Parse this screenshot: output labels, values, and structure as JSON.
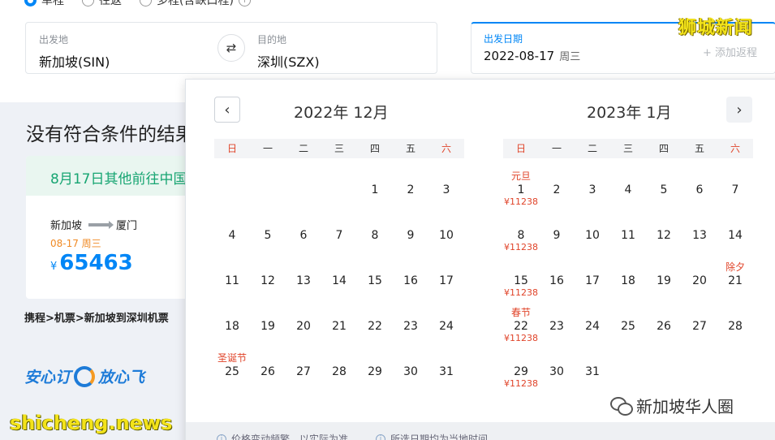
{
  "trip_types": [
    {
      "label": "单程",
      "selected": true
    },
    {
      "label": "往返",
      "selected": false
    },
    {
      "label": "多程(含缺口程)",
      "selected": false
    }
  ],
  "search": {
    "from_label": "出发地",
    "from_value": "新加坡(SIN)",
    "to_label": "目的地",
    "to_value": "深圳(SZX)",
    "date_label": "出发日期",
    "date_value": "2022-08-17",
    "date_weekday": "周三",
    "add_return": "+ 添加返程"
  },
  "background": {
    "no_result_title": "没有符合条件的结果",
    "promo_head": "8月17日其他前往中国",
    "route_from": "新加坡",
    "route_to": "厦门",
    "route_date": "08-17 周三",
    "price_symbol": "¥",
    "price_value": "65463",
    "breadcrumb": "携程>机票>新加坡到深圳机票",
    "slogan_a": "安心订",
    "slogan_b": "放心飞"
  },
  "calendar": {
    "left_title": "2022年 12月",
    "right_title": "2023年 1月",
    "weekdays": [
      "日",
      "一",
      "二",
      "三",
      "四",
      "五",
      "六"
    ],
    "footer_notes": [
      "价格变动频繁，以实际为准",
      "所选日期均为当地时间"
    ],
    "months": [
      {
        "first_weekday": 4,
        "days": 31,
        "festivals": {
          "25": "圣诞节"
        },
        "fares": {}
      },
      {
        "first_weekday": 0,
        "days": 31,
        "festivals": {
          "1": "元旦",
          "21": "除夕",
          "22": "春节"
        },
        "fares": {
          "1": "¥11238",
          "8": "¥11238",
          "15": "¥11238",
          "22": "¥11238",
          "29": "¥11238"
        }
      }
    ]
  },
  "watermarks": {
    "top_right": "狮城新闻",
    "bottom_left": "shicheng.news",
    "bottom_right": "新加坡华人圈"
  },
  "colors": {
    "accent": "#0086f6",
    "holiday_red": "#e0442a",
    "promo_green": "#17a572"
  }
}
